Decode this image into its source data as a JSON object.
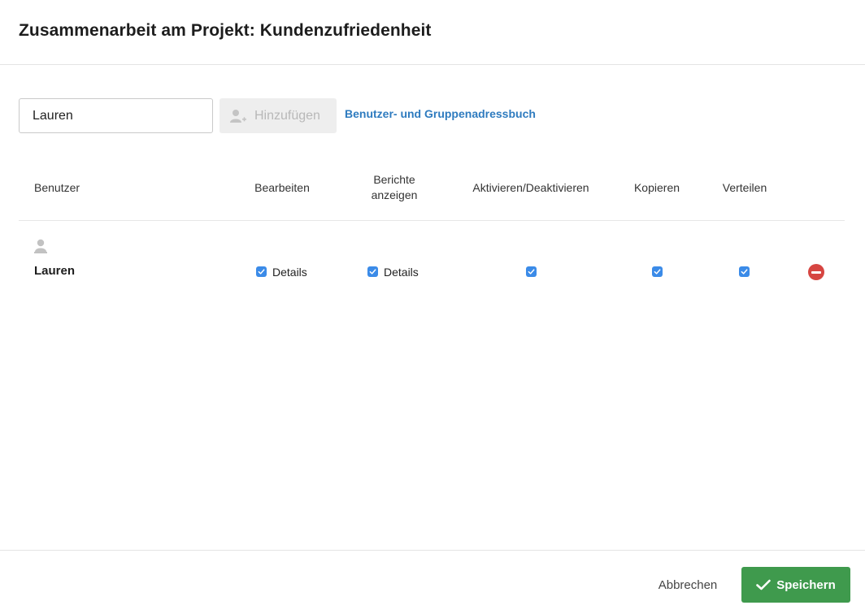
{
  "dialog": {
    "title": "Zusammenarbeit am Projekt: Kundenzufriedenheit"
  },
  "search": {
    "value": "Lauren",
    "placeholder": ""
  },
  "add_button": {
    "label": "Hinzufügen",
    "icon": "add-user-icon"
  },
  "addressbook_link": "Benutzer- und Gruppenadressbuch",
  "table": {
    "headers": {
      "user": "Benutzer",
      "edit": "Bearbeiten",
      "reports_line1": "Berichte",
      "reports_line2": "anzeigen",
      "activate": "Aktivieren/Deaktivieren",
      "copy": "Kopieren",
      "distribute": "Verteilen"
    },
    "rows": [
      {
        "user": "Lauren",
        "edit": {
          "checked": true,
          "label": "Details"
        },
        "reports": {
          "checked": true,
          "label": "Details"
        },
        "activate": {
          "checked": true
        },
        "copy": {
          "checked": true
        },
        "distribute": {
          "checked": true
        }
      }
    ]
  },
  "footer": {
    "cancel_label": "Abbrechen",
    "save_label": "Speichern"
  },
  "colors": {
    "accent_blue": "#3b8be8",
    "link": "#2e7bbf",
    "save_green": "#3f9a4d",
    "remove_red": "#d64541"
  }
}
